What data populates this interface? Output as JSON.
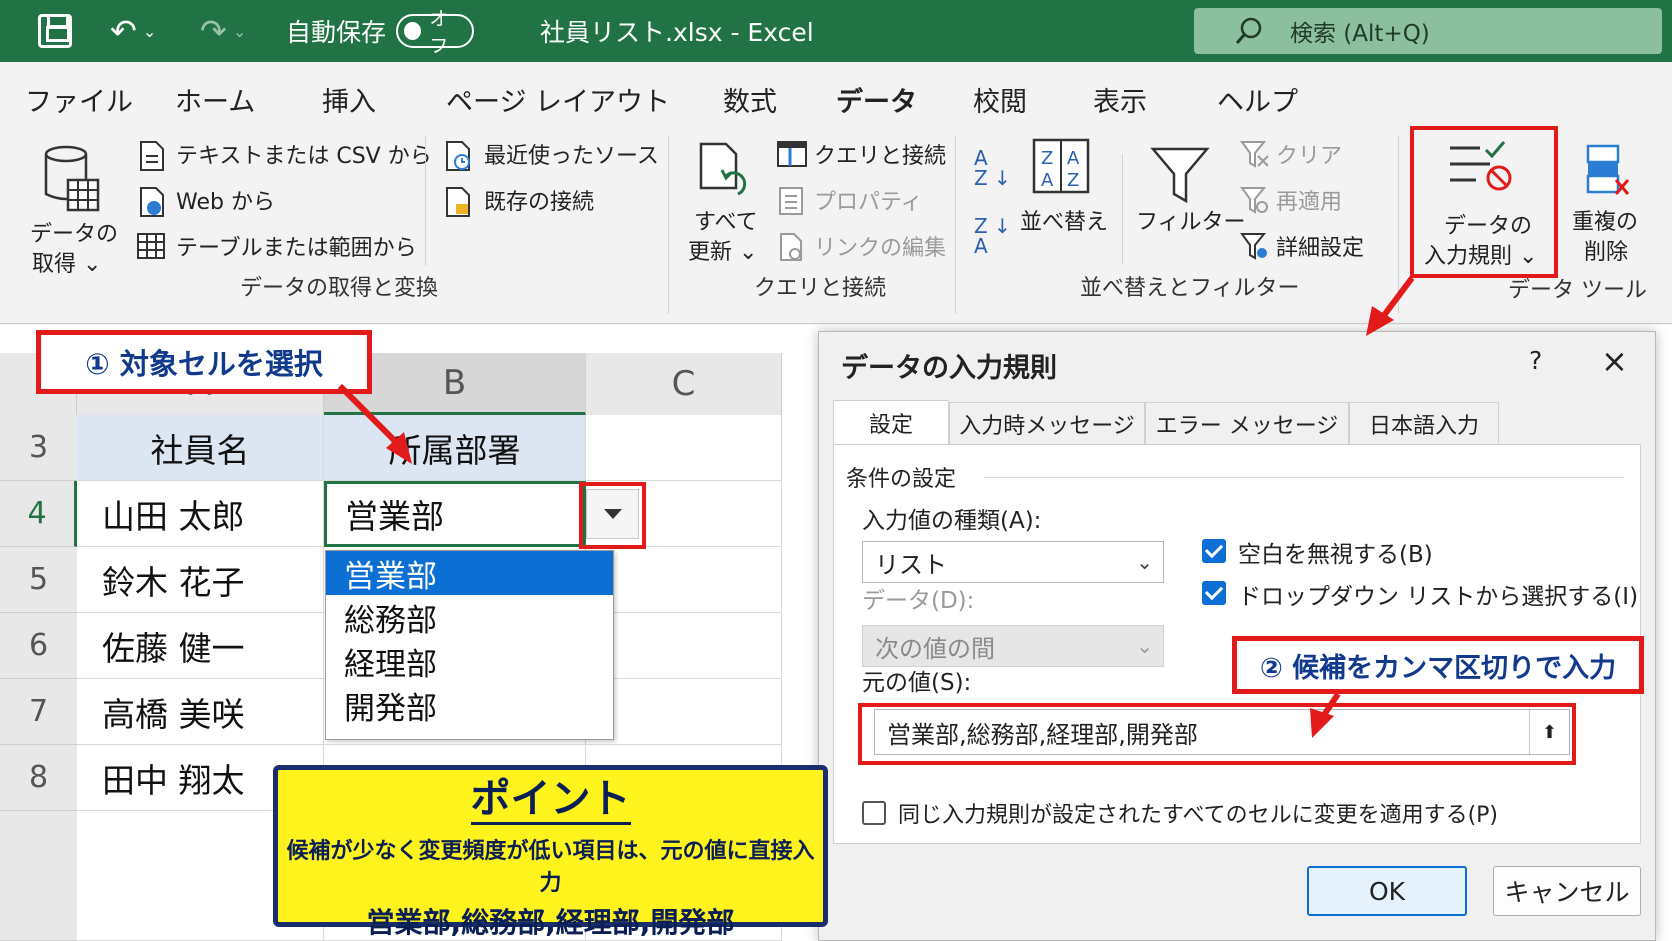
{
  "titlebar": {
    "autosave_label": "自動保存",
    "autosave_state": "オフ",
    "doc_title": "社員リスト.xlsx  -  Excel",
    "search_text": "検索 (Alt+Q)"
  },
  "tabs": [
    "ファイル",
    "ホーム",
    "挿入",
    "ページ レイアウト",
    "数式",
    "データ",
    "校閲",
    "表示",
    "ヘルプ"
  ],
  "ribbon": {
    "get_data": [
      "データの",
      "取得 ⌄"
    ],
    "text_csv": "テキストまたは CSV から",
    "web": "Web から",
    "table_range": "テーブルまたは範囲から",
    "recent_sources": "最近使ったソース",
    "existing_conn": "既存の接続",
    "group_get": "データの取得と変換",
    "refresh_all": [
      "すべて",
      "更新 ⌄"
    ],
    "queries_conn": "クエリと接続",
    "properties": "プロパティ",
    "edit_links": "リンクの編集",
    "group_query": "クエリと接続",
    "sort": "並べ替え",
    "filter": "フィルター",
    "clear": "クリア",
    "reapply": "再適用",
    "advanced": "詳細設定",
    "group_sort": "並べ替えとフィルター",
    "data_validation": [
      "データの",
      "入力規則 ⌄"
    ],
    "remove_dup": [
      "重複の",
      "削除"
    ],
    "group_tools": "データ ツール"
  },
  "sheet": {
    "columns": [
      "A",
      "B",
      "C"
    ],
    "rows": [
      "3",
      "4",
      "5",
      "6",
      "7",
      "8"
    ],
    "header": [
      "社員名",
      "所属部署"
    ],
    "names": [
      "山田 太郎",
      "鈴木 花子",
      "佐藤 健一",
      "高橋 美咲",
      "田中 翔太"
    ],
    "b4": "営業部",
    "dropdown": [
      "営業部",
      "総務部",
      "経理部",
      "開発部"
    ]
  },
  "dialog": {
    "title": "データの入力規則",
    "help": "?",
    "close": "×",
    "tabs": [
      "設定",
      "入力時メッセージ",
      "エラー メッセージ",
      "日本語入力"
    ],
    "section": "条件の設定",
    "allow_label": "入力値の種類(A):",
    "allow_value": "リスト",
    "data_label": "データ(D):",
    "data_value": "次の値の間",
    "ignore_blank": "空白を無視する(B)",
    "in_cell_dropdown": "ドロップダウン リストから選択する(I)",
    "source_label": "元の値(S):",
    "source_value": "営業部,総務部,経理部,開発部",
    "apply_all": "同じ入力規則が設定されたすべてのセルに変更を適用する(P)",
    "ok": "OK",
    "cancel": "キャンセル"
  },
  "annotations": {
    "step1": "① 対象セルを選択",
    "step2": "② 候補をカンマ区切りで入力",
    "point_title": "ポイント",
    "point_line1": "候補が少なく変更頻度が低い項目は、元の値に直接入力",
    "point_line2": "営業部,総務部,経理部,開発部"
  },
  "colors": {
    "excel_green": "#217346",
    "accent_red": "#e21a1a",
    "select_blue": "#0b6fd3",
    "point_yellow": "#fff31e"
  }
}
